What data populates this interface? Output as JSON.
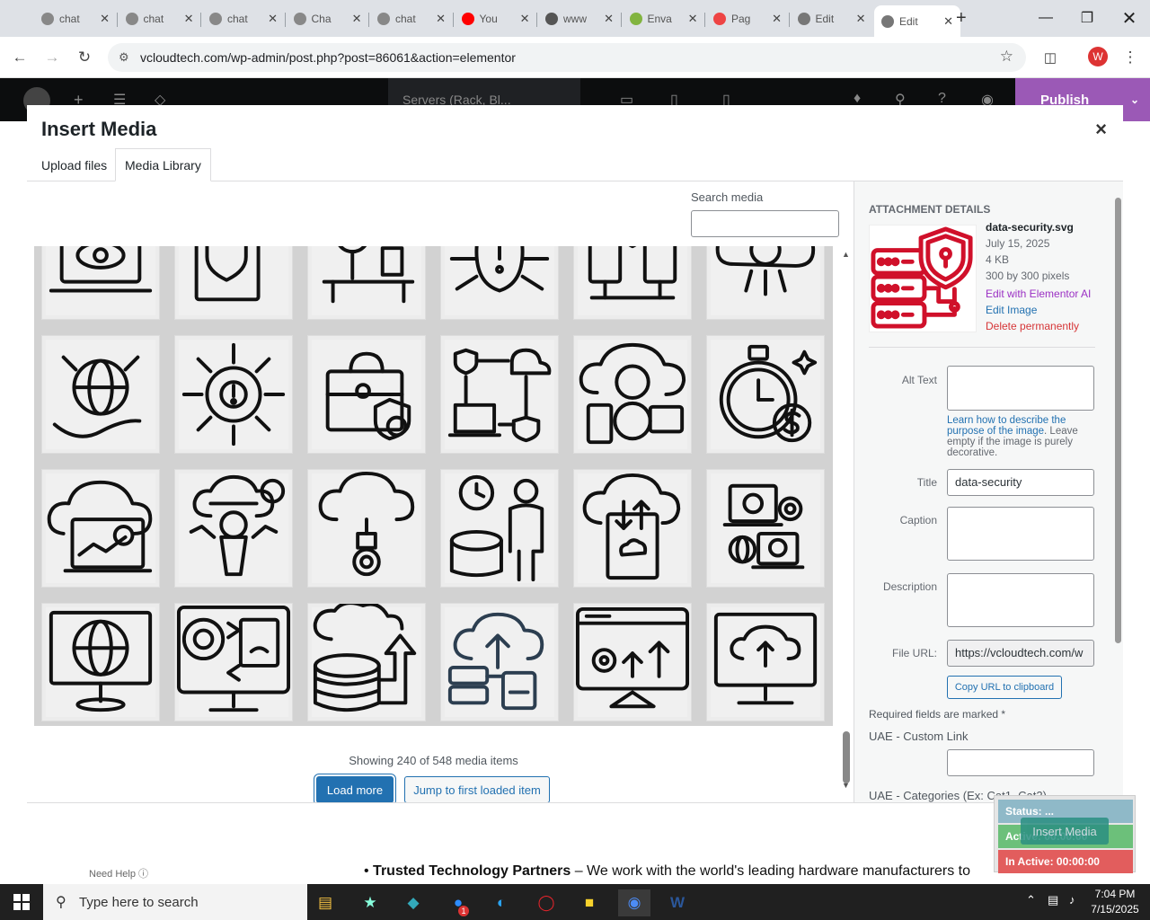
{
  "browser": {
    "tabs": [
      {
        "label": "chat",
        "icon": "chatgpt-icon"
      },
      {
        "label": "chat",
        "icon": "chatgpt-icon"
      },
      {
        "label": "chat",
        "icon": "chatgpt-icon"
      },
      {
        "label": "Cha",
        "icon": "chatgpt-icon"
      },
      {
        "label": "chat",
        "icon": "chatgpt-icon"
      },
      {
        "label": "You",
        "icon": "youtube-icon"
      },
      {
        "label": "www",
        "icon": "wordpress-icon"
      },
      {
        "label": "Enva",
        "icon": "envato-icon"
      },
      {
        "label": "Pag",
        "icon": "page-icon"
      },
      {
        "label": "Edit",
        "icon": "globe-icon"
      },
      {
        "label": "Edit",
        "icon": "globe-icon"
      }
    ],
    "url": "vcloudtech.com/wp-admin/post.php?post=86061&action=elementor",
    "profile_letter": "W"
  },
  "elementor": {
    "doc_name": "Servers (Rack, Bl...",
    "publish_label": "Publish"
  },
  "modal": {
    "title": "Insert Media",
    "close_glyph": "×",
    "tabs": [
      "Upload files",
      "Media Library"
    ],
    "search_label": "Search media",
    "search_value": "",
    "showing_text": "Showing 240 of 548 media items",
    "load_more_label": "Load more",
    "jump_label": "Jump to first loaded item",
    "grid_icons": [
      "eye-laptop-icon",
      "shield-gear-document-icon",
      "magnifier-desk-icon",
      "bug-circuit-icon",
      "server-network-icon",
      "cloud-brain-icon",
      "globe-hand-tools-icon",
      "gear-warning-circuit-icon",
      "briefcase-shield-icon",
      "shield-cloud-laptop-icon",
      "cloud-devices-icon",
      "stopwatch-dollar-icon",
      "cloud-laptop-chart-icon",
      "person-cloud-arrows-icon",
      "cloud-lightbulb-gear-icon",
      "clock-database-person-icon",
      "cloud-document-transfer-icon",
      "laptop-globe-gear-icon",
      "monitor-globe-icon",
      "monitor-switch-icon",
      "cloud-database-arrow-icon",
      "cloud-upload-servers-icon",
      "monitor-dashboard-icon",
      "monitor-cloud-upload-icon"
    ]
  },
  "attachment": {
    "heading": "ATTACHMENT DETAILS",
    "filename": "data-security.svg",
    "date": "July 15, 2025",
    "size": "4 KB",
    "dimensions": "300 by 300 pixels",
    "edit_ai": "Edit with Elementor AI",
    "edit_image": "Edit Image",
    "delete": "Delete permanently",
    "alt_label": "Alt Text",
    "alt_value": "",
    "alt_help_link": "Learn how to describe the purpose of the image",
    "alt_help_rest": ". Leave empty if the image is purely decorative.",
    "title_label": "Title",
    "title_value": "data-security",
    "caption_label": "Caption",
    "caption_value": "",
    "description_label": "Description",
    "description_value": "",
    "fileurl_label": "File URL:",
    "fileurl_value": "https://vcloudtech.com/w",
    "copy_label": "Copy URL to clipboard",
    "required_text": "Required fields are marked *",
    "uae_link_label": "UAE - Custom Link",
    "uae_categories_label": "UAE - Categories (Ex: Cat1, Cat2)",
    "accent_color": "#d0102a"
  },
  "status_widget": {
    "status": "Status: ...",
    "active": "Active: 00:00:00",
    "inactive": "In Active: 00:00:00",
    "insert_label": "Insert Media"
  },
  "background": {
    "bullet_bold": "Trusted Technology Partners",
    "bullet_rest": " – We work with the world's leading hardware manufacturers to",
    "need_help": "Need Help"
  },
  "taskbar": {
    "search_placeholder": "Type here to search",
    "time": "7:04 PM",
    "date": "7/15/2025",
    "badge": "1"
  }
}
